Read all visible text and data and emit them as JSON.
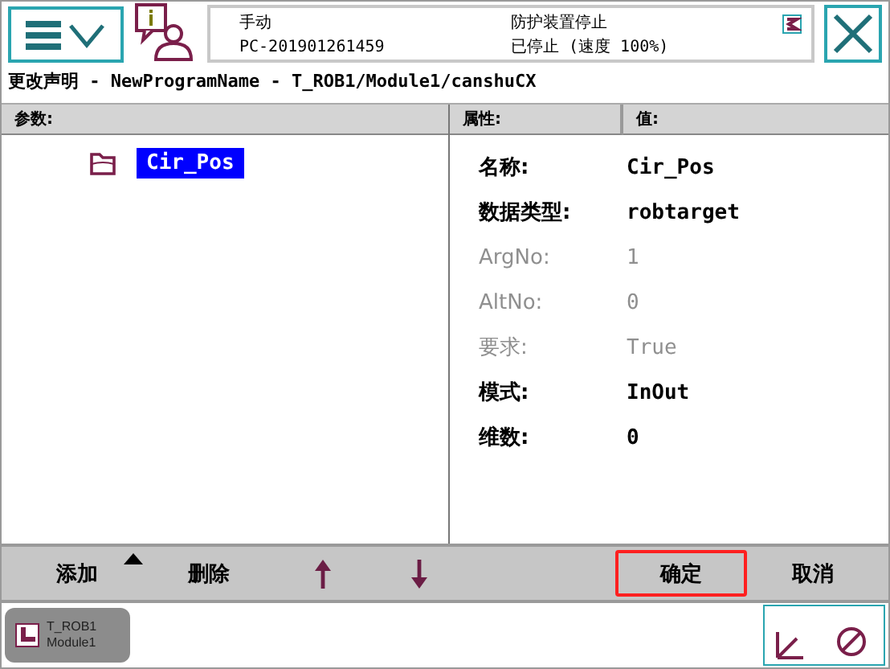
{
  "status": {
    "mode": "手动",
    "controller": "PC-201901261459",
    "safety": "防护装置停止",
    "state": "已停止 (速度 100%)"
  },
  "breadcrumb": "更改声明 - NewProgramName - T_ROB1/Module1/canshuCX",
  "parameters": {
    "heading": "参数:",
    "items": [
      {
        "name": "Cir_Pos",
        "selected": true
      }
    ]
  },
  "properties": {
    "columns": [
      "属性:",
      "值:"
    ],
    "rows": [
      {
        "label": "名称:",
        "value": "Cir_Pos",
        "disabled": false
      },
      {
        "label": "数据类型:",
        "value": "robtarget",
        "disabled": false
      },
      {
        "label": "ArgNo:",
        "value": "1",
        "disabled": true
      },
      {
        "label": "AltNo:",
        "value": "0",
        "disabled": true
      },
      {
        "label": "要求:",
        "value": "True",
        "disabled": true
      },
      {
        "label": "模式:",
        "value": "InOut",
        "disabled": false
      },
      {
        "label": "维数:",
        "value": "0",
        "disabled": false
      }
    ]
  },
  "toolbar": [
    {
      "kind": "text",
      "label": "添加",
      "menu": true,
      "highlighted": false
    },
    {
      "kind": "text",
      "label": "删除",
      "menu": false,
      "highlighted": false
    },
    {
      "kind": "up"
    },
    {
      "kind": "down"
    },
    {
      "kind": "spacer"
    },
    {
      "kind": "text",
      "label": "确定",
      "menu": false,
      "highlighted": true
    },
    {
      "kind": "text",
      "label": "取消",
      "menu": false,
      "highlighted": false
    }
  ],
  "taskbar": [
    {
      "line1": "T_ROB1",
      "line2": "Module1"
    }
  ]
}
